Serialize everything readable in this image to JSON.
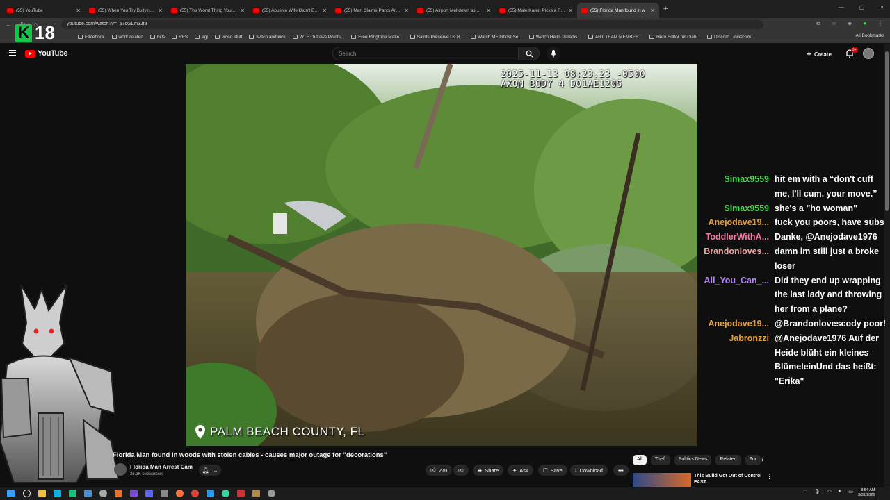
{
  "browser": {
    "tabs": [
      {
        "title": "(55) YouTube",
        "active": false
      },
      {
        "title": "(55) When You Try Bullying The",
        "active": false
      },
      {
        "title": "(55) The Worst Thing You Could",
        "active": false
      },
      {
        "title": "(55) Abusive Wife Didn't Expect",
        "active": false
      },
      {
        "title": "(55) Man Claims Pants Aren't Hi",
        "active": false
      },
      {
        "title": "(55) Airport Meltdown as Drunk",
        "active": false
      },
      {
        "title": "(55) Male Karen Picks a Fight V",
        "active": false
      },
      {
        "title": "(55) Florida Man found in w",
        "active": true
      }
    ],
    "new_tab": "+",
    "url": "youtube.com/watch?v=_57cGLm3Jt8",
    "bookmarks": [
      "Facebook",
      "work related",
      "bills",
      "RFS",
      "egl",
      "video stuff",
      "twitch and kick",
      "WTF Outlaws Points...",
      "Free Ringtone Make...",
      "Saints Preserve Us R...",
      "Watch MF Ghost Se...",
      "Watch Hell's Paradis...",
      "ART TEAM MEMBER...",
      "Hero Editor for Diab...",
      "Discord | #welcom..."
    ],
    "all_bookmarks": "All Bookmarks"
  },
  "overlay": {
    "badge_letter": "K",
    "badge_number": "18"
  },
  "youtube": {
    "logo": "YouTube",
    "search_placeholder": "Search",
    "create_label": "Create",
    "notif_count": "9+"
  },
  "video": {
    "timestamp_line1": "2025-11-13 08:23:23 -0500",
    "timestamp_line2": "AXON BODY 4 D01AE120S",
    "location": "PALM BEACH COUNTY, FL",
    "title": "Florida Man found in woods with stolen cables - causes major outage for \"decorations\"",
    "channel": "Florida Man Arrest Cam",
    "subscribers": "25.3K subscribers",
    "likes": "270",
    "actions": {
      "share": "Share",
      "ask": "Ask",
      "save": "Save",
      "download": "Download"
    }
  },
  "chat": [
    {
      "user": "Simax9559",
      "color": "#3ddc4a",
      "text": "hit em with a “don't cuff me, I'll cum. your move.”"
    },
    {
      "user": "Simax9559",
      "color": "#3ddc4a",
      "text": "she's a \"ho woman\""
    },
    {
      "user": "Anejodave19...",
      "color": "#e8a03a",
      "text": "fuck you poors, have subs"
    },
    {
      "user": "ToddlerWithA...",
      "color": "#f07aa6",
      "text": "Danke, @Anejodave1976"
    },
    {
      "user": "Brandonloves...",
      "color": "#f2a7a7",
      "text": "damn im still just a broke loser"
    },
    {
      "user": "All_You_Can_...",
      "color": "#b685ff",
      "text": "Did they end up wrapping the last lady and throwing her from a plane?"
    },
    {
      "user": "Anejodave19...",
      "color": "#e8a03a",
      "text": "@Brandonlovescody poor!"
    },
    {
      "user": "Jabronzzi",
      "color": "#e8a03a",
      "text": "@Anejodave1976 Auf der Heide blüht ein kleines BlümeleinUnd das heißt: \"Erika\""
    }
  ],
  "chips": [
    "All",
    "Theft",
    "Politics News",
    "Related",
    "For"
  ],
  "recommended": {
    "title": "This Build Got Out of Control FAST..."
  },
  "clock": {
    "time": "8:54 AM",
    "date": "3/31/2026"
  }
}
